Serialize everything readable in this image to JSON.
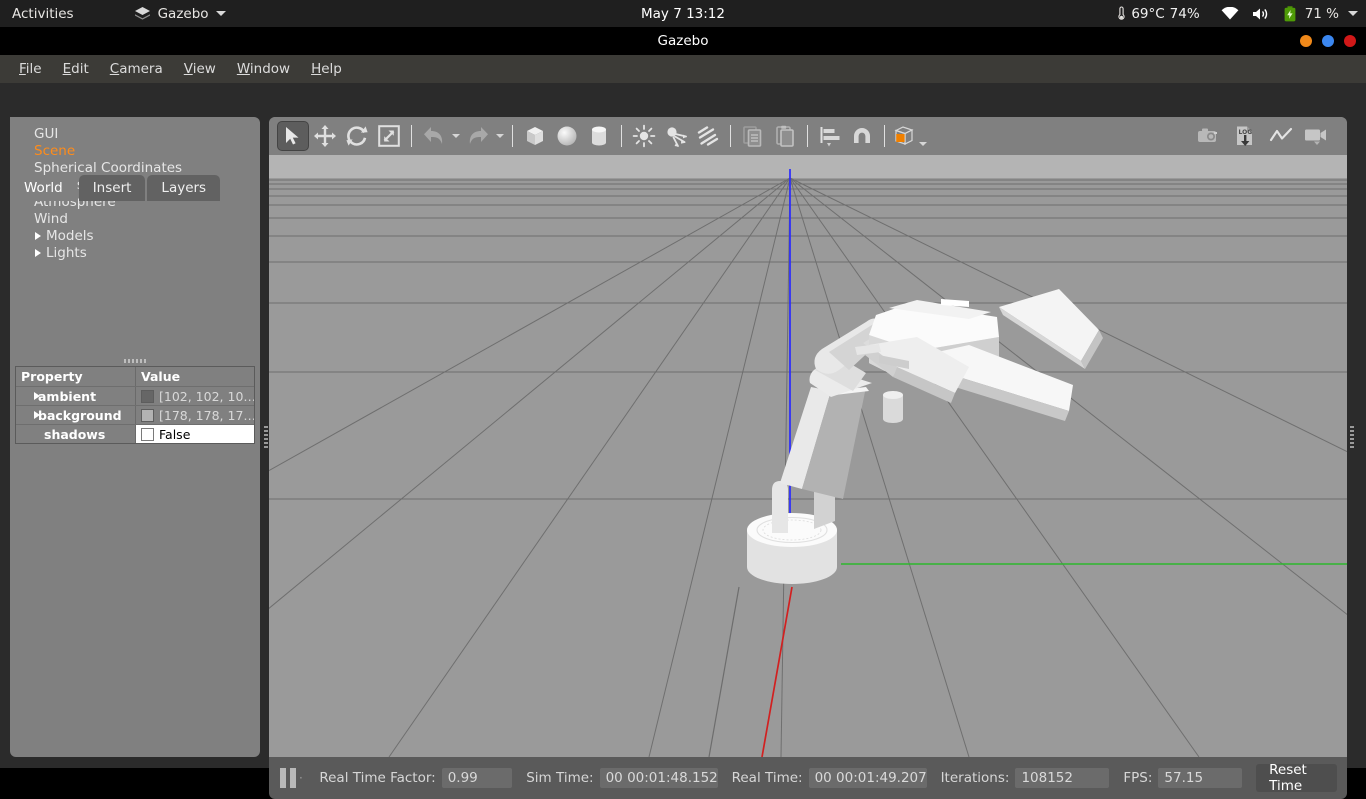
{
  "gnome": {
    "activities": "Activities",
    "app_name": "Gazebo",
    "app_icon": "gazebo-icon",
    "clock": "May 7  13:12",
    "temperature": "69°C",
    "cpu_percent": "74%",
    "battery": "71 %",
    "icons": [
      "thermometer-icon",
      "wifi-icon",
      "volume-icon",
      "battery-icon",
      "chevron-down-icon"
    ]
  },
  "window": {
    "title": "Gazebo",
    "buttons": [
      "minimize-button",
      "maximize-button",
      "close-button"
    ],
    "colors": {
      "minimize": "#f0891a",
      "maximize": "#3b87f0",
      "close": "#d01818"
    }
  },
  "menubar": {
    "items": [
      {
        "label": "File",
        "mnemonic": "F"
      },
      {
        "label": "Edit",
        "mnemonic": "E"
      },
      {
        "label": "Camera",
        "mnemonic": "C"
      },
      {
        "label": "View",
        "mnemonic": "V"
      },
      {
        "label": "Window",
        "mnemonic": "W"
      },
      {
        "label": "Help",
        "mnemonic": "H"
      }
    ]
  },
  "left_panel": {
    "tabs": [
      {
        "label": "World",
        "active": true
      },
      {
        "label": "Insert",
        "active": false
      },
      {
        "label": "Layers",
        "active": false
      }
    ],
    "tree": [
      {
        "label": "GUI",
        "expandable": false,
        "selected": false
      },
      {
        "label": "Scene",
        "expandable": false,
        "selected": true
      },
      {
        "label": "Spherical Coordinates",
        "expandable": false,
        "selected": false
      },
      {
        "label": "Physics",
        "expandable": false,
        "selected": false
      },
      {
        "label": "Atmosphere",
        "expandable": false,
        "selected": false
      },
      {
        "label": "Wind",
        "expandable": false,
        "selected": false
      },
      {
        "label": "Models",
        "expandable": true,
        "selected": false
      },
      {
        "label": "Lights",
        "expandable": true,
        "selected": false
      }
    ],
    "selection_color": "#ff8c1a",
    "property_table": {
      "headers": [
        "Property",
        "Value"
      ],
      "rows": [
        {
          "property": "ambient",
          "value": "[102, 102, 10…",
          "swatch": "#666666",
          "expandable": true,
          "kind": "color"
        },
        {
          "property": "background",
          "value": "[178, 178, 17…",
          "swatch": "#b2b2b2",
          "expandable": true,
          "kind": "color"
        },
        {
          "property": "shadows",
          "value": "False",
          "checked": false,
          "expandable": false,
          "kind": "bool"
        }
      ]
    }
  },
  "toolbar": {
    "left_items": [
      {
        "name": "select-mode-button",
        "icon": "cursor-arrow-icon",
        "active": true
      },
      {
        "name": "translate-mode-button",
        "icon": "move-arrows-icon",
        "active": false
      },
      {
        "name": "rotate-mode-button",
        "icon": "rotate-icon",
        "active": false
      },
      {
        "name": "scale-mode-button",
        "icon": "scale-icon",
        "active": false
      },
      {
        "name": "undo-button",
        "icon": "undo-arrow-icon",
        "active": false
      },
      {
        "name": "undo-history-dropdown",
        "icon": "chevron-down-icon",
        "active": false
      },
      {
        "name": "redo-button",
        "icon": "redo-arrow-icon",
        "active": false
      },
      {
        "name": "redo-history-dropdown",
        "icon": "chevron-down-icon",
        "active": false
      },
      {
        "name": "insert-box-button",
        "icon": "box-icon",
        "active": false
      },
      {
        "name": "insert-sphere-button",
        "icon": "sphere-icon",
        "active": false
      },
      {
        "name": "insert-cylinder-button",
        "icon": "cylinder-icon",
        "active": false
      },
      {
        "name": "insert-point-light-button",
        "icon": "point-light-icon",
        "active": false
      },
      {
        "name": "insert-spot-light-button",
        "icon": "spot-light-icon",
        "active": false
      },
      {
        "name": "insert-directional-light-button",
        "icon": "directional-light-icon",
        "active": false
      },
      {
        "name": "copy-button",
        "icon": "copy-icon",
        "active": false
      },
      {
        "name": "paste-button",
        "icon": "paste-icon",
        "active": false
      },
      {
        "name": "align-button",
        "icon": "align-icon",
        "active": false
      },
      {
        "name": "snap-button",
        "icon": "snap-magnet-icon",
        "active": false
      },
      {
        "name": "view-angle-button",
        "icon": "view-angle-cube-icon",
        "active": false
      }
    ],
    "right_items": [
      {
        "name": "screenshot-button",
        "icon": "camera-icon"
      },
      {
        "name": "log-data-button",
        "icon": "log-download-icon"
      },
      {
        "name": "plot-button",
        "icon": "plot-line-icon"
      },
      {
        "name": "record-video-button",
        "icon": "video-camera-icon"
      }
    ],
    "accent_color": "#f08000"
  },
  "scene": {
    "sky_color": "#b4b4b4",
    "ground_color": "#9a9a9a",
    "grid_color": "#6e6e6e",
    "axis_z_color": "#2a2aff",
    "axis_x_color": "#e02020",
    "axis_y_color": "#22bb22",
    "model_name": "robot-arm-model",
    "model_color": "#f2f2f2"
  },
  "bottombar": {
    "pause_button": "pause-icon",
    "step_button": "step-icon",
    "fields": [
      {
        "label": "Real Time Factor:",
        "value": "0.99",
        "name": "real-time-factor"
      },
      {
        "label": "Sim Time:",
        "value": "00 00:01:48.152",
        "name": "sim-time"
      },
      {
        "label": "Real Time:",
        "value": "00 00:01:49.207",
        "name": "real-time"
      },
      {
        "label": "Iterations:",
        "value": "108152",
        "name": "iterations"
      },
      {
        "label": "FPS:",
        "value": "57.15",
        "name": "fps"
      }
    ],
    "reset_label": "Reset Time"
  }
}
